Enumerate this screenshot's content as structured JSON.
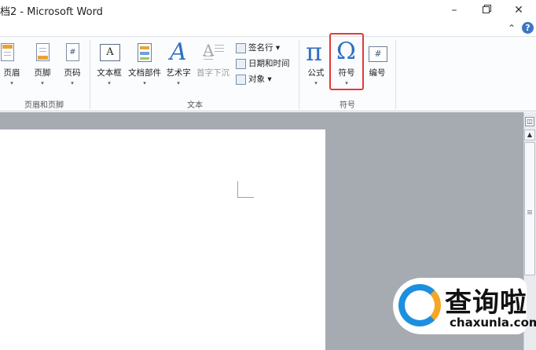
{
  "window": {
    "title": "档2 - Microsoft Word",
    "minimize_icon": "minimize-icon",
    "restore_icon": "restore-icon",
    "close_icon": "close-icon"
  },
  "tabrow": {
    "collapse_glyph": "⌃",
    "help_glyph": "?"
  },
  "ribbon": {
    "groups": [
      {
        "label": "页眉和页脚",
        "buttons": [
          {
            "label": "页眉",
            "icon": "header-icon"
          },
          {
            "label": "页脚",
            "icon": "footer-icon"
          },
          {
            "label": "页码",
            "icon": "page-number-icon"
          }
        ]
      },
      {
        "label": "文本",
        "buttons": [
          {
            "label": "文本框",
            "icon": "textbox-icon"
          },
          {
            "label": "文档部件",
            "icon": "quick-parts-icon"
          },
          {
            "label": "艺术字",
            "icon": "wordart-icon"
          },
          {
            "label": "首字下沉",
            "icon": "drop-cap-icon"
          }
        ],
        "small_buttons": [
          {
            "label": "签名行 ▾",
            "icon": "signature-line-icon"
          },
          {
            "label": "日期和时间",
            "icon": "date-time-icon"
          },
          {
            "label": "对象 ▾",
            "icon": "object-icon"
          }
        ]
      },
      {
        "label": "符号",
        "buttons": [
          {
            "label": "公式",
            "icon": "equation-icon",
            "glyph": "π"
          },
          {
            "label": "符号",
            "icon": "symbol-icon",
            "glyph": "Ω"
          },
          {
            "label": "编号",
            "icon": "numbering-icon",
            "glyph": "#"
          }
        ]
      }
    ],
    "dropdown_arrow": "▾"
  },
  "scrollbar": {
    "ruler_glyph": "◫",
    "up_glyph": "▲"
  },
  "watermark": {
    "text_cn": "查询啦",
    "text_en": "chaxunla.com"
  },
  "colors": {
    "highlight": "#e23a3a",
    "accent": "#3c76c4"
  }
}
